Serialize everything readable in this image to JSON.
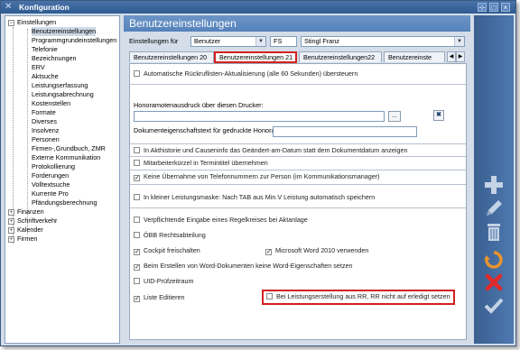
{
  "window": {
    "title": "Konfiguration"
  },
  "titlebar_buttons": {
    "pin": "⊹",
    "restore": "□",
    "close": "×"
  },
  "tree": {
    "items": [
      {
        "label": "Einstellungen",
        "expander": "−"
      },
      {
        "label": "Benutzereinstellungen"
      },
      {
        "label": "Programmgrundeinstellungen"
      },
      {
        "label": "Telefonie"
      },
      {
        "label": "Bezeichnungen"
      },
      {
        "label": "ERV"
      },
      {
        "label": "Aktsuche"
      },
      {
        "label": "Leistungserfassung"
      },
      {
        "label": "Leistungsabrechnung"
      },
      {
        "label": "Kostenstellen"
      },
      {
        "label": "Formate"
      },
      {
        "label": "Diverses"
      },
      {
        "label": "Insolvenz"
      },
      {
        "label": "Personen"
      },
      {
        "label": "Firmen-,Grundbuch, ZMR"
      },
      {
        "label": "Externe Kommunikation"
      },
      {
        "label": "Protokollierung"
      },
      {
        "label": "Forderungen"
      },
      {
        "label": "Volltextsuche"
      },
      {
        "label": "Kurrente Pro"
      },
      {
        "label": "Pfändungsberechnung"
      },
      {
        "label": "Finanzen",
        "expander": "+"
      },
      {
        "label": "Schriftverkehr",
        "expander": "+"
      },
      {
        "label": "Kalender",
        "expander": "+"
      },
      {
        "label": "Firmen",
        "expander": "+"
      }
    ]
  },
  "main": {
    "header": "Benutzereinstellungen",
    "settings_for_label": "Einstellungen für",
    "settings_for_value": "Benutzer",
    "user_code": "FS",
    "user_name": "Stingl Franz",
    "tabs": [
      {
        "label": "Benutzereinstellungen 20"
      },
      {
        "label": "Benutzereinstellungen 21"
      },
      {
        "label": "Benutzereinstellungen22"
      },
      {
        "label": "Benutzereinste"
      }
    ],
    "tab_arrows": {
      "left": "◀",
      "right": "▶"
    }
  },
  "panel": {
    "auto_refresh": "Automatische Rückruflisten-Aktualisierung (alle 60 Sekunden) übersteuern",
    "printer_label": "Honoramotenausdruck über diesen Drucker:",
    "printer_value": "",
    "browse_label": "...",
    "doc_prop_label": "Dokumenteigenschaftstext für gedruckte Honoramoten",
    "doc_prop_value": "",
    "checks": [
      {
        "label": "In Akthistorie und Causeninfo das Geändert-am-Datum statt dem Dokumentdatum anzeigen",
        "checked": false
      },
      {
        "label": "Mitarbeiterkürzel in Termintitel übernehmen",
        "checked": false
      },
      {
        "label": "Keine Übernahme von Telefonnummern zur Person (im Kommunikationsmanager)",
        "checked": true
      },
      {
        "label": "In kleiner Leistungsmaske: Nach TAB aus Min.V Leistung automatisch speichern",
        "checked": false
      },
      {
        "label": "Verpflichtende Eingabe eines Regelkreises bei Aktanlage",
        "checked": false
      },
      {
        "label": "ÖBB Rechtsabteilung",
        "checked": false
      },
      {
        "label": "Cockpit freischalten",
        "checked": true
      },
      {
        "label": "Microsoft Word 2010 verwenden",
        "checked": true
      },
      {
        "label": "Beim Erstellen von Word-Dokumenten keine Word-Eigenschaften setzen",
        "checked": true
      },
      {
        "label": "UID-Prüfzeitraum",
        "checked": false
      },
      {
        "label": "Liste Editieren",
        "checked": true
      },
      {
        "label": "Bei Leistungserstellung aus RR, RR nicht auf erledigt setzen",
        "checked": false
      }
    ],
    "check_mark": "✓"
  },
  "toolbar": {
    "icons": [
      "add-icon",
      "edit-icon",
      "delete-trash-icon",
      "refresh-icon",
      "cancel-icon",
      "confirm-icon"
    ]
  },
  "colors": {
    "title": "#2e5a92",
    "header": "#5a86be",
    "accent_red": "#d42020"
  }
}
